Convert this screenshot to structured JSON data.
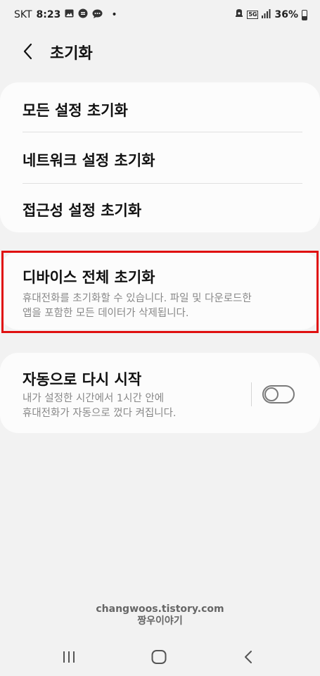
{
  "status_bar": {
    "carrier": "SKT",
    "time": "8:23",
    "dot": "•",
    "network_badge": "5G",
    "battery_percent": "36%",
    "icons": [
      "gallery-icon",
      "messenger-icon",
      "talk-icon",
      "alarm-icon",
      "5g-icon",
      "signal-icon",
      "battery-icon"
    ]
  },
  "header": {
    "title": "초기화",
    "back_icon": "chevron-left-icon"
  },
  "reset_options": [
    {
      "label": "모든 설정 초기화"
    },
    {
      "label": "네트워크 설정 초기화"
    },
    {
      "label": "접근성 설정 초기화"
    }
  ],
  "factory_reset": {
    "title": "디바이스 전체 초기화",
    "description_line1": "휴대전화를 초기화할 수 있습니다. 파일 및 다운로드한",
    "description_line2": "앱을 포함한 모든 데이터가 삭제됩니다.",
    "highlight_color": "#e01010"
  },
  "auto_restart": {
    "title": "자동으로 다시 시작",
    "description_line1": "내가 설정한 시간에서 1시간 안에",
    "description_line2": "휴대전화가 자동으로 껐다 켜집니다.",
    "enabled": false
  },
  "watermark": {
    "line1": "changwoos.tistory.com",
    "line2": "짱우이야기"
  },
  "nav_bar": {
    "icons": [
      "recent-apps-icon",
      "home-icon",
      "back-icon"
    ]
  }
}
